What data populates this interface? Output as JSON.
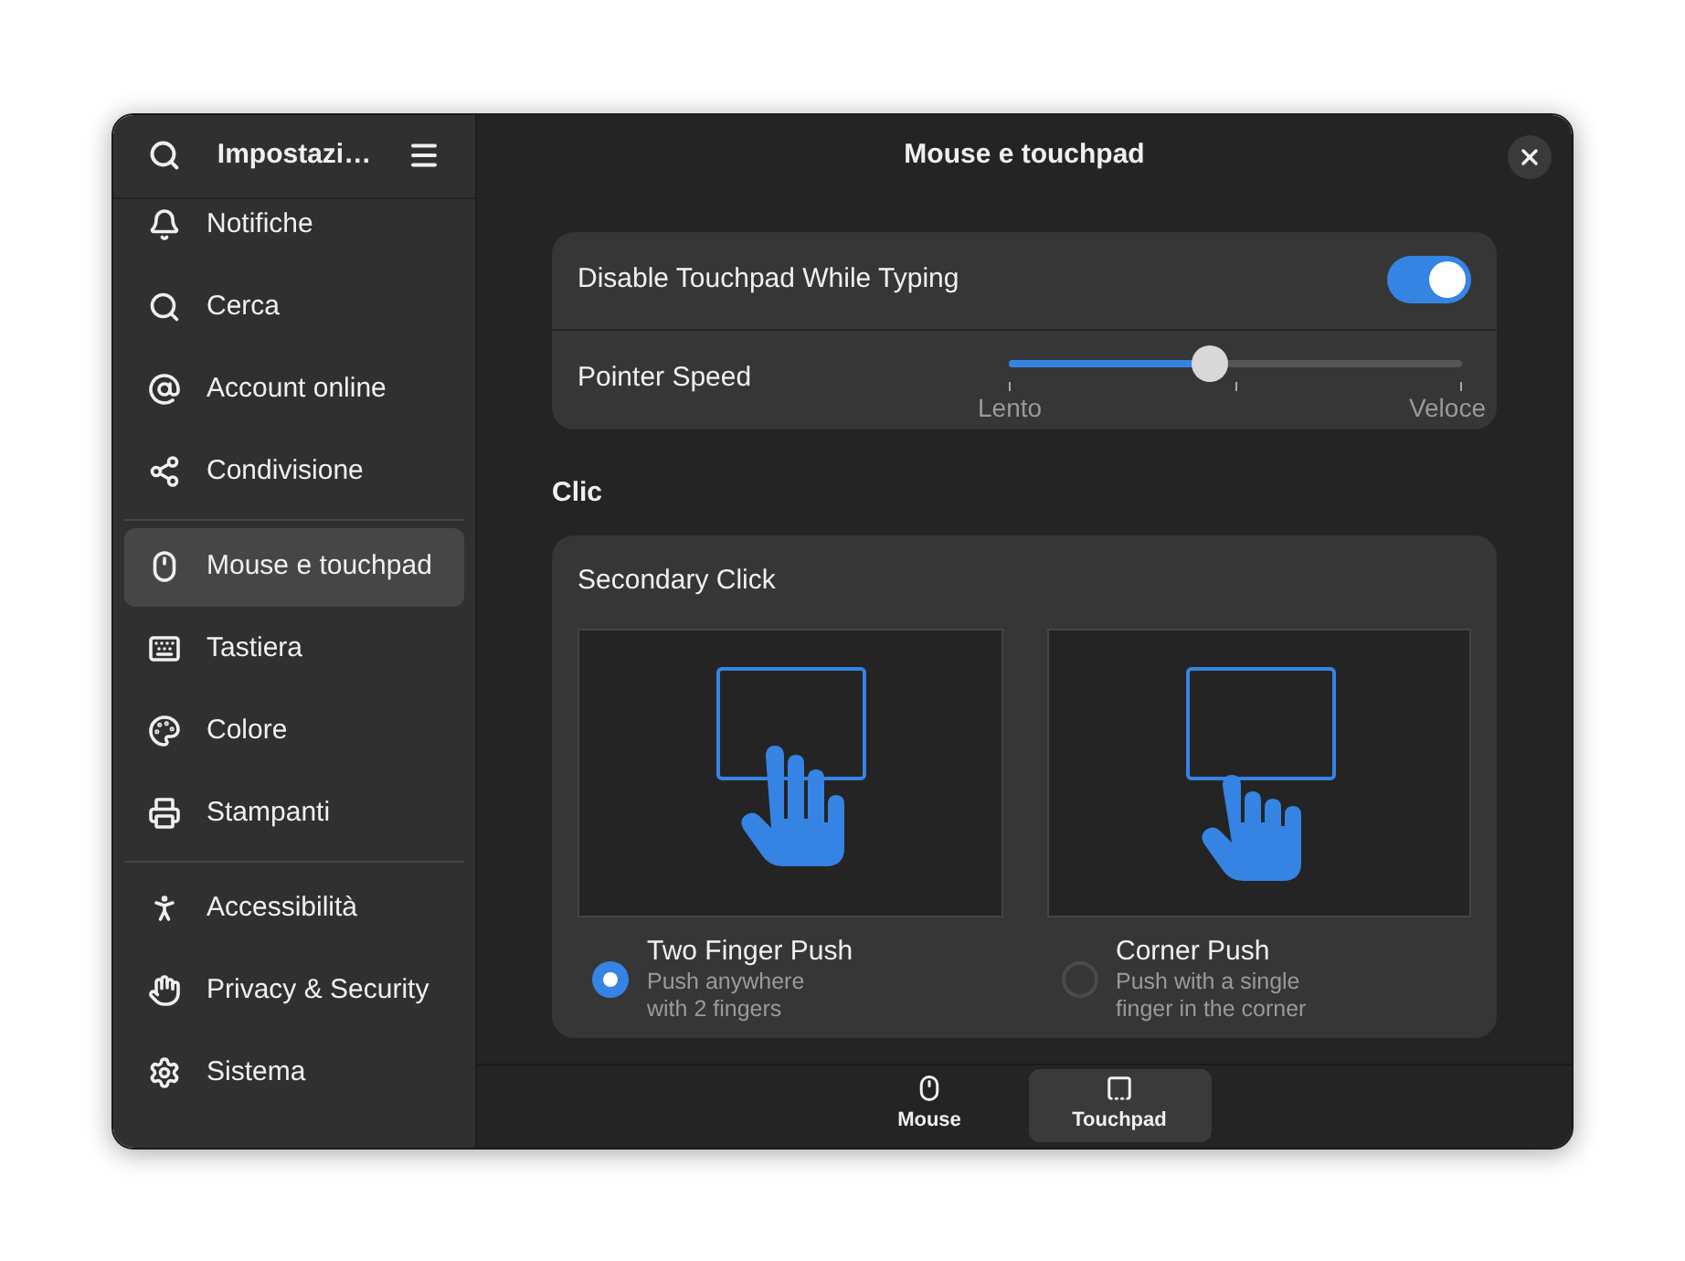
{
  "sidebar": {
    "title": "Impostazi…",
    "groups": [
      [
        {
          "label": "Notifiche",
          "selected": false
        },
        {
          "label": "Cerca",
          "selected": false
        },
        {
          "label": "Account online",
          "selected": false
        },
        {
          "label": "Condivisione",
          "selected": false
        }
      ],
      [
        {
          "label": "Mouse e touchpad",
          "selected": true
        },
        {
          "label": "Tastiera",
          "selected": false
        },
        {
          "label": "Colore",
          "selected": false
        },
        {
          "label": "Stampanti",
          "selected": false
        }
      ],
      [
        {
          "label": "Accessibilità",
          "selected": false
        },
        {
          "label": "Privacy & Security",
          "selected": false
        },
        {
          "label": "Sistema",
          "selected": false
        }
      ]
    ]
  },
  "header": {
    "title": "Mouse e touchpad"
  },
  "general": {
    "toggle": {
      "label": "Disable Touchpad While Typing",
      "on": true
    },
    "speed": {
      "label": "Pointer Speed",
      "level": 0.445,
      "min_label": "Lento",
      "max_label": "Veloce"
    }
  },
  "click": {
    "heading": "Clic",
    "card_title": "Secondary Click",
    "options": [
      {
        "title": "Two Finger Push",
        "description": "Push anywhere\nwith 2 fingers",
        "selected": true
      },
      {
        "title": "Corner Push",
        "description": "Push with a single\nfinger in the corner",
        "selected": false
      }
    ]
  },
  "view_switcher": [
    {
      "label": "Mouse",
      "selected": false
    },
    {
      "label": "Touchpad",
      "selected": true
    }
  ]
}
